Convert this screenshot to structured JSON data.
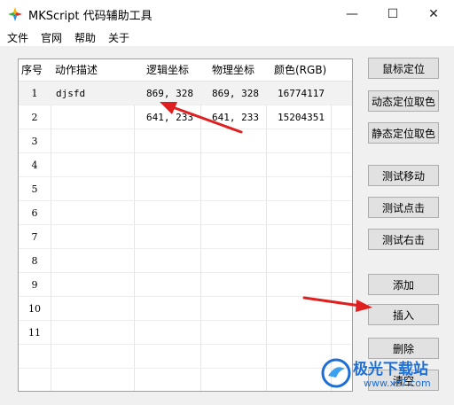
{
  "window": {
    "title": "MKScript 代码辅助工具",
    "minimize_glyph": "—",
    "maximize_glyph": "☐",
    "close_glyph": "✕"
  },
  "menu": [
    {
      "label": "文件"
    },
    {
      "label": "官网"
    },
    {
      "label": "帮助"
    },
    {
      "label": "关于"
    }
  ],
  "table": {
    "headers": [
      "序号",
      "动作描述",
      "逻辑坐标",
      "物理坐标",
      "颜色(RGB)"
    ],
    "rows": [
      {
        "num": "1",
        "desc": "djsfd",
        "logical": "869, 328",
        "physical": "869, 328",
        "color": "16774117",
        "selected": true
      },
      {
        "num": "2",
        "desc": "",
        "logical": "641, 233",
        "physical": "641, 233",
        "color": "15204351"
      },
      {
        "num": "3",
        "desc": "",
        "logical": "",
        "physical": "",
        "color": ""
      },
      {
        "num": "4",
        "desc": "",
        "logical": "",
        "physical": "",
        "color": ""
      },
      {
        "num": "5",
        "desc": "",
        "logical": "",
        "physical": "",
        "color": ""
      },
      {
        "num": "6",
        "desc": "",
        "logical": "",
        "physical": "",
        "color": ""
      },
      {
        "num": "7",
        "desc": "",
        "logical": "",
        "physical": "",
        "color": ""
      },
      {
        "num": "8",
        "desc": "",
        "logical": "",
        "physical": "",
        "color": ""
      },
      {
        "num": "9",
        "desc": "",
        "logical": "",
        "physical": "",
        "color": ""
      },
      {
        "num": "10",
        "desc": "",
        "logical": "",
        "physical": "",
        "color": ""
      },
      {
        "num": "11",
        "desc": "",
        "logical": "",
        "physical": "",
        "color": ""
      }
    ]
  },
  "buttons": {
    "mouse_locate": "鼠标定位",
    "dynamic_locate_color": "动态定位取色",
    "static_locate_color": "静态定位取色",
    "test_move": "测试移动",
    "test_click": "测试点击",
    "test_right_click": "测试右击",
    "add": "添加",
    "insert": "插入",
    "delete": "删除",
    "clear": "清空"
  },
  "watermark": {
    "brand": "极光下载站",
    "url": "www.xz7.com"
  },
  "colors": {
    "annotation_arrow": "#e02020",
    "watermark_blue": "#1d6fd6"
  }
}
